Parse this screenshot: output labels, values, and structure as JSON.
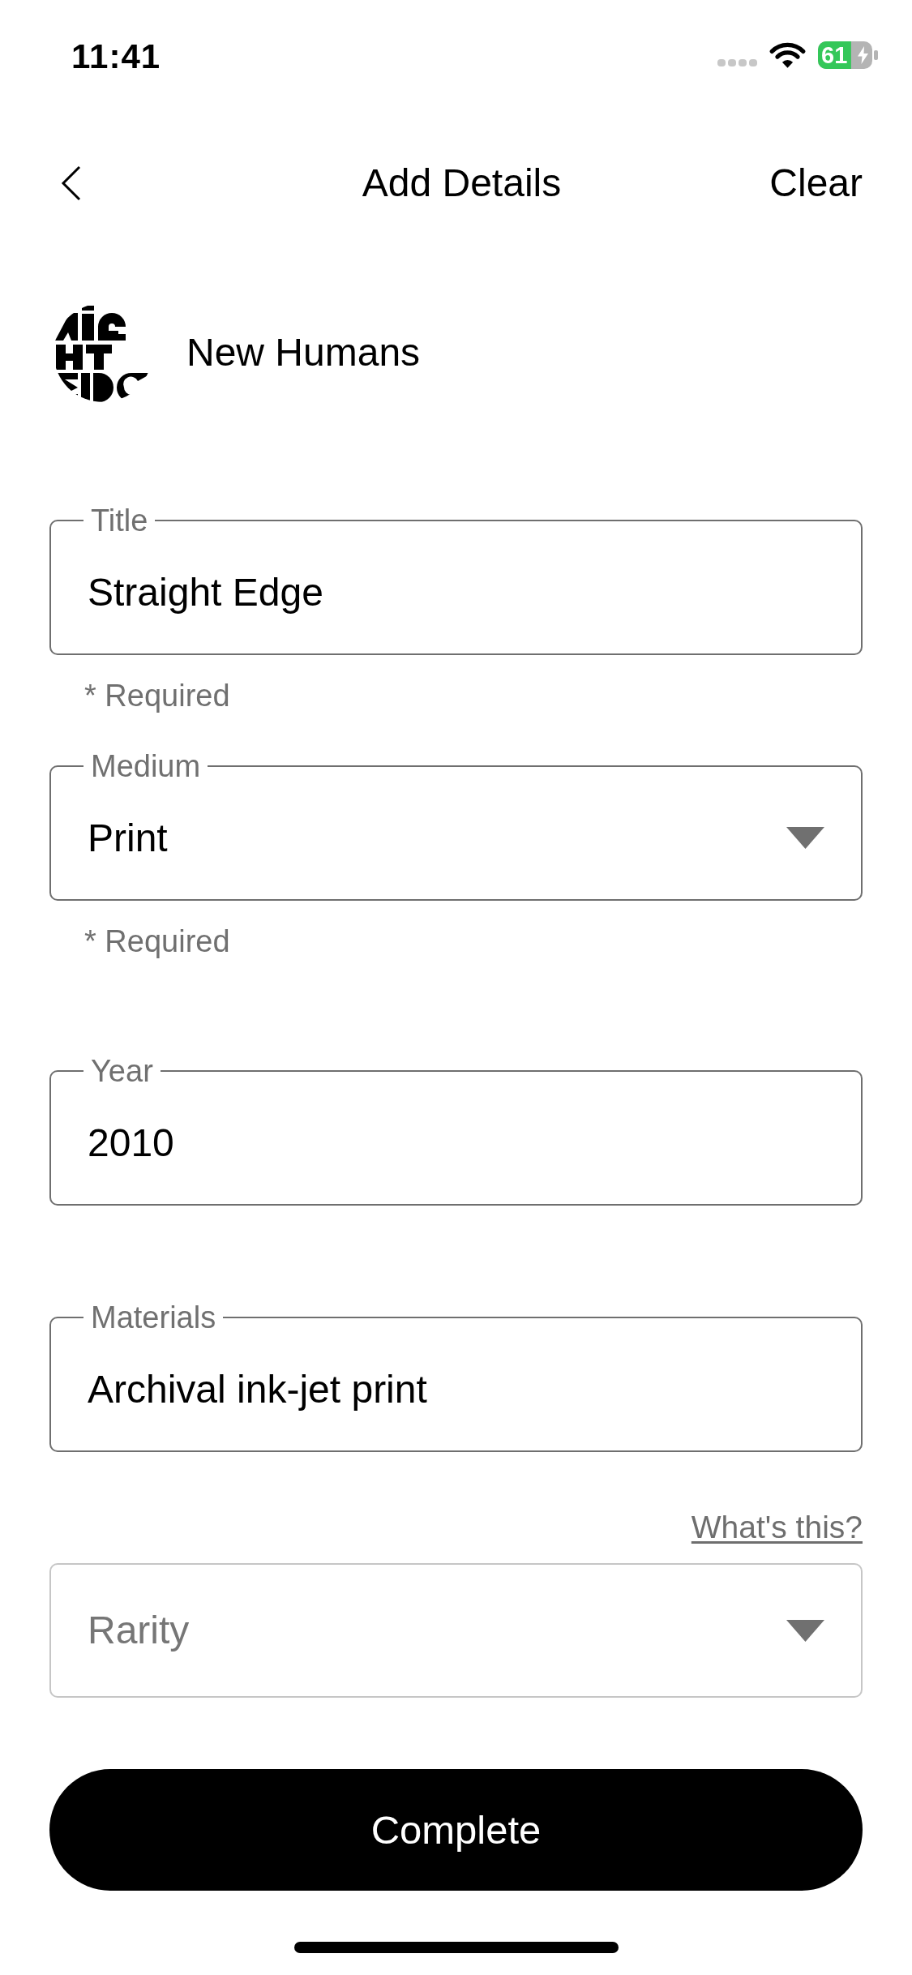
{
  "status_bar": {
    "time": "11:41",
    "battery": "61"
  },
  "header": {
    "title": "Add Details",
    "action": "Clear"
  },
  "artist": {
    "name": "New Humans"
  },
  "fields": [
    {
      "kind": "text",
      "label": "Title",
      "value": "Straight Edge",
      "helper": "* Required"
    },
    {
      "kind": "select",
      "label": "Medium",
      "value": "Print",
      "helper": "* Required"
    },
    {
      "kind": "text",
      "label": "Year",
      "value": "2010"
    },
    {
      "kind": "text",
      "label": "Materials",
      "value": "Archival ink-jet print"
    },
    {
      "kind": "select",
      "placeholder": "Rarity",
      "link": "What's this?"
    }
  ],
  "primary_button": "Complete"
}
